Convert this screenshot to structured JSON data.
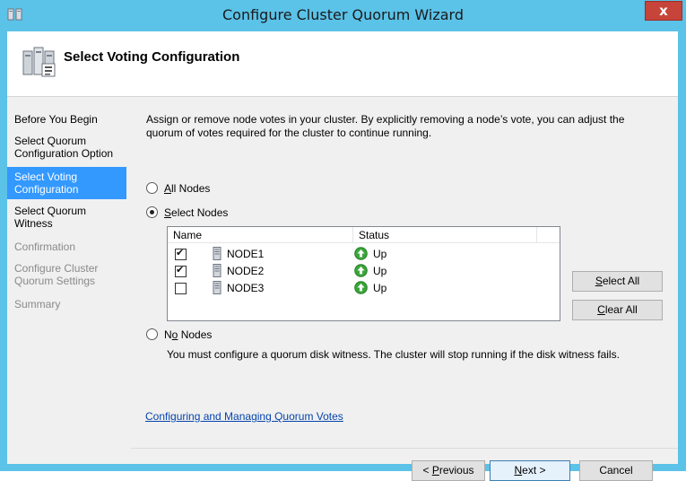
{
  "window": {
    "title": "Configure Cluster Quorum Wizard",
    "close_label": "x"
  },
  "header": {
    "title": "Select Voting Configuration"
  },
  "nav": {
    "items": [
      {
        "label": "Before You Begin",
        "state": "enabled"
      },
      {
        "label": "Select Quorum Configuration Option",
        "state": "enabled"
      },
      {
        "label": "Select Voting Configuration",
        "state": "selected"
      },
      {
        "label": "Select Quorum Witness",
        "state": "enabled"
      },
      {
        "label": "Confirmation",
        "state": "disabled"
      },
      {
        "label": "Configure Cluster Quorum Settings",
        "state": "disabled"
      },
      {
        "label": "Summary",
        "state": "disabled"
      }
    ]
  },
  "main": {
    "description": "Assign or remove node votes in your cluster. By explicitly removing a node’s vote, you can adjust the quorum of votes required for the cluster to continue running.",
    "options": {
      "all_nodes": {
        "pre": "",
        "key": "A",
        "post": "ll Nodes",
        "selected": false
      },
      "select_nodes": {
        "pre": "",
        "key": "S",
        "post": "elect Nodes",
        "selected": true
      },
      "no_nodes": {
        "pre": "N",
        "key": "o",
        "post": " Nodes",
        "selected": false
      }
    },
    "list": {
      "columns": {
        "name": "Name",
        "status": "Status"
      },
      "rows": [
        {
          "checked": true,
          "name": "NODE1",
          "status": "Up"
        },
        {
          "checked": true,
          "name": "NODE2",
          "status": "Up"
        },
        {
          "checked": false,
          "name": "NODE3",
          "status": "Up"
        }
      ]
    },
    "select_all": {
      "pre": "",
      "key": "S",
      "post": "elect All"
    },
    "clear_all": {
      "pre": "",
      "key": "C",
      "post": "lear All"
    },
    "no_nodes_note": "You must configure a quorum disk witness. The cluster will stop running if the disk witness fails.",
    "help_link": "Configuring and Managing Quorum Votes"
  },
  "footer": {
    "previous": {
      "pre": "< ",
      "key": "P",
      "post": "revious"
    },
    "next": {
      "pre": "",
      "key": "N",
      "post": "ext >"
    },
    "cancel": "Cancel"
  },
  "colors": {
    "accent": "#3399ff",
    "frame": "#5bc2e8",
    "close": "#c7443a",
    "status_up": "#3aa63a"
  }
}
